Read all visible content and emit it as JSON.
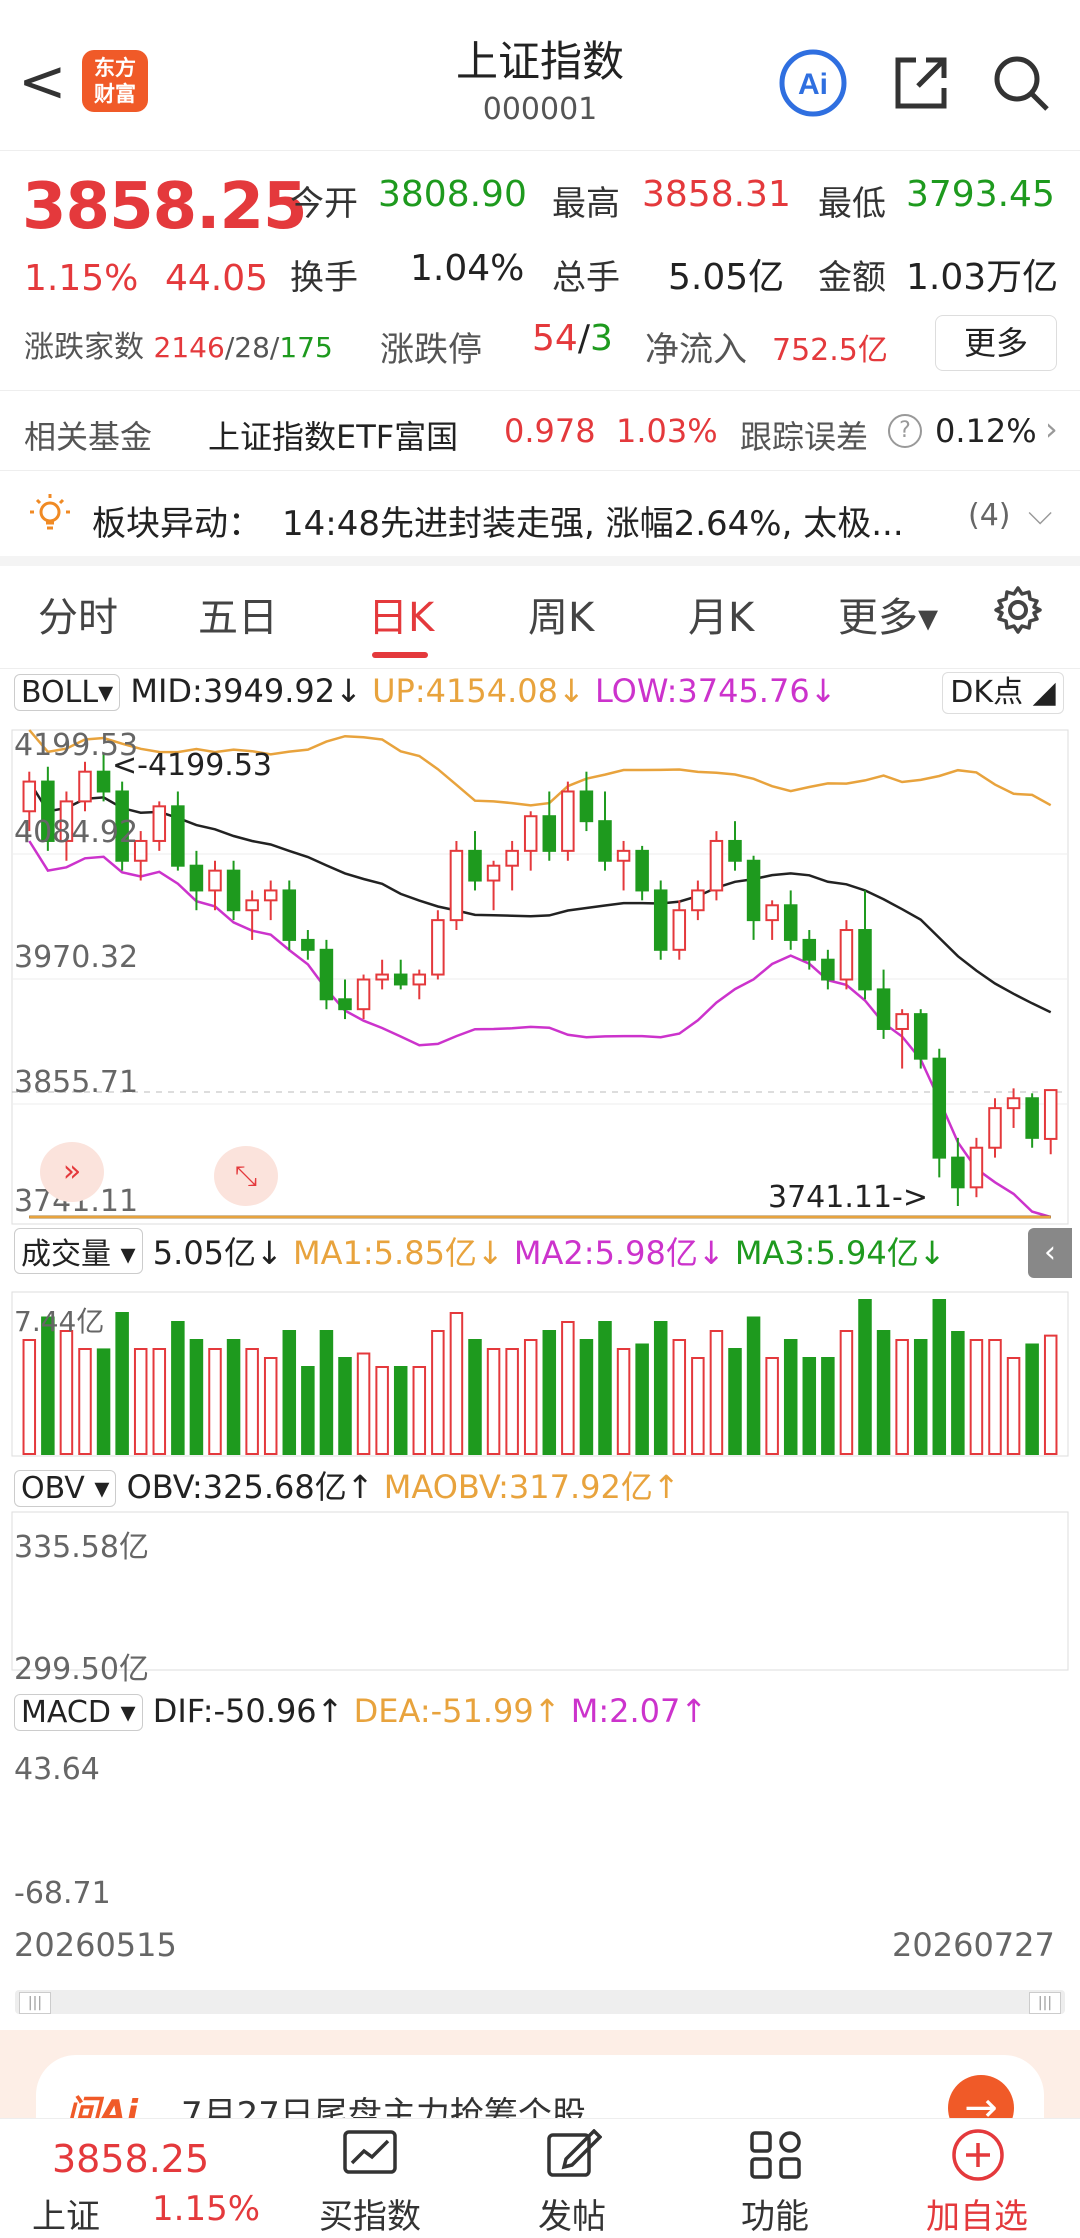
{
  "header": {
    "back": "<",
    "logo_line1": "东方",
    "logo_line2": "财富",
    "title": "上证指数",
    "code": "000001",
    "ai_label": "Ai"
  },
  "quote": {
    "price": "3858.25",
    "pct": "1.15%",
    "change": "44.05",
    "open_label": "今开",
    "open": "3808.90",
    "high_label": "最高",
    "high": "3858.31",
    "low_label": "最低",
    "low": "3793.45",
    "turnover_label": "换手",
    "turnover": "1.04%",
    "volume_label": "总手",
    "volume": "5.05亿",
    "amount_label": "金额",
    "amount": "1.03万亿",
    "breadth_label": "涨跌家数",
    "breadth_up": "2146",
    "breadth_flat": "28",
    "breadth_down": "175",
    "limit_label": "涨跌停",
    "limit_up": "54",
    "limit_down": "3",
    "inflow_label": "净流入",
    "inflow": "752.5亿",
    "more": "更多"
  },
  "fund": {
    "label": "相关基金",
    "name": "上证指数ETF富国",
    "price": "0.978",
    "pct": "1.03%",
    "err_label": "跟踪误差",
    "err": "0.12%"
  },
  "sector": {
    "label": "板块异动：",
    "text": "14:48先进封装走强, 涨幅2.64%, 太极...",
    "count": "(4)"
  },
  "tabs": [
    "分时",
    "五日",
    "日K",
    "周K",
    "月K",
    "更多▾"
  ],
  "boll": {
    "name": "BOLL",
    "mid": "MID:3949.92↓",
    "up": "UP:4154.08↓",
    "low": "LOW:3745.76↓",
    "dk": "DK点"
  },
  "price_axis": {
    "t1": "4199.53",
    "t2": "4084.92",
    "t3": "3970.32",
    "t4": "3855.71",
    "t5": "3741.11",
    "max_note": "<-4199.53",
    "min_note": "3741.11->"
  },
  "vol": {
    "name": "成交量",
    "v": "5.05亿↓",
    "ma1": "MA1:5.85亿↓",
    "ma2": "MA2:5.98亿↓",
    "ma3": "MA3:5.94亿↓",
    "axis": "7.44亿"
  },
  "obv": {
    "name": "OBV",
    "v": "OBV:325.68亿↑",
    "ma": "MAOBV:317.92亿↑",
    "top": "335.58亿",
    "bot": "299.50亿"
  },
  "macd": {
    "name": "MACD",
    "dif": "DIF:-50.96↑",
    "dea": "DEA:-51.99↑",
    "m": "M:2.07↑",
    "top": "43.64",
    "bot": "-68.71"
  },
  "dates": {
    "start": "20260515",
    "end": "20260727"
  },
  "promo": {
    "text": "7月27日尾盘主力抢筹个股"
  },
  "bottom": {
    "price": "3858.25",
    "name": "上证",
    "pct": "1.15%",
    "b1": "买指数",
    "b2": "发帖",
    "b3": "功能",
    "b4": "加自选"
  },
  "colors": {
    "up": "#e4393c",
    "down": "#1e9a1e",
    "mid": "#222222",
    "upper": "#e8a33d",
    "lower": "#cc33cc"
  },
  "chart_data": {
    "type": "candlestick",
    "candles": [
      [
        4140,
        4180,
        4120,
        4170
      ],
      [
        4170,
        4185,
        4100,
        4110
      ],
      [
        4110,
        4160,
        4090,
        4150
      ],
      [
        4150,
        4190,
        4140,
        4180
      ],
      [
        4180,
        4199.53,
        4150,
        4160
      ],
      [
        4160,
        4170,
        4080,
        4090
      ],
      [
        4090,
        4120,
        4070,
        4110
      ],
      [
        4110,
        4150,
        4100,
        4145
      ],
      [
        4145,
        4160,
        4080,
        4085
      ],
      [
        4085,
        4100,
        4040,
        4060
      ],
      [
        4060,
        4090,
        4040,
        4080
      ],
      [
        4080,
        4090,
        4030,
        4040
      ],
      [
        4040,
        4060,
        4010,
        4050
      ],
      [
        4050,
        4070,
        4030,
        4060
      ],
      [
        4060,
        4070,
        4000,
        4010
      ],
      [
        4010,
        4020,
        3990,
        4000
      ],
      [
        4000,
        4010,
        3940,
        3950
      ],
      [
        3950,
        3970,
        3930,
        3940
      ],
      [
        3940,
        3975,
        3930,
        3970
      ],
      [
        3970,
        3990,
        3960,
        3975
      ],
      [
        3975,
        3990,
        3960,
        3965
      ],
      [
        3965,
        3980,
        3950,
        3975
      ],
      [
        3975,
        4040,
        3970,
        4030
      ],
      [
        4030,
        4110,
        4020,
        4100
      ],
      [
        4100,
        4120,
        4060,
        4070
      ],
      [
        4070,
        4090,
        4040,
        4085
      ],
      [
        4085,
        4110,
        4060,
        4100
      ],
      [
        4100,
        4140,
        4080,
        4135
      ],
      [
        4135,
        4160,
        4090,
        4100
      ],
      [
        4100,
        4170,
        4090,
        4160
      ],
      [
        4160,
        4180,
        4120,
        4130
      ],
      [
        4130,
        4160,
        4080,
        4090
      ],
      [
        4090,
        4110,
        4060,
        4100
      ],
      [
        4100,
        4105,
        4050,
        4060
      ],
      [
        4060,
        4070,
        3990,
        4000
      ],
      [
        4000,
        4050,
        3990,
        4040
      ],
      [
        4040,
        4070,
        4030,
        4060
      ],
      [
        4060,
        4120,
        4050,
        4110
      ],
      [
        4110,
        4130,
        4080,
        4090
      ],
      [
        4090,
        4095,
        4010,
        4030
      ],
      [
        4030,
        4050,
        4010,
        4045
      ],
      [
        4045,
        4060,
        4000,
        4010
      ],
      [
        4010,
        4020,
        3980,
        3990
      ],
      [
        3990,
        4000,
        3960,
        3970
      ],
      [
        3970,
        4030,
        3960,
        4020
      ],
      [
        4020,
        4060,
        3950,
        3960
      ],
      [
        3960,
        3980,
        3910,
        3920
      ],
      [
        3920,
        3940,
        3880,
        3935
      ],
      [
        3935,
        3940,
        3880,
        3890
      ],
      [
        3890,
        3900,
        3770,
        3790
      ],
      [
        3790,
        3810,
        3741.11,
        3760
      ],
      [
        3760,
        3810,
        3750,
        3800
      ],
      [
        3800,
        3850,
        3790,
        3840
      ],
      [
        3840,
        3860,
        3820,
        3850
      ],
      [
        3850,
        3855,
        3800,
        3810
      ],
      [
        3808.9,
        3858.31,
        3793.45,
        3858.25
      ]
    ],
    "volume_axis_max": "7.44亿",
    "obv_range": [
      "299.50亿",
      "335.58亿"
    ],
    "macd_range": [
      -68.71,
      43.64
    ]
  }
}
